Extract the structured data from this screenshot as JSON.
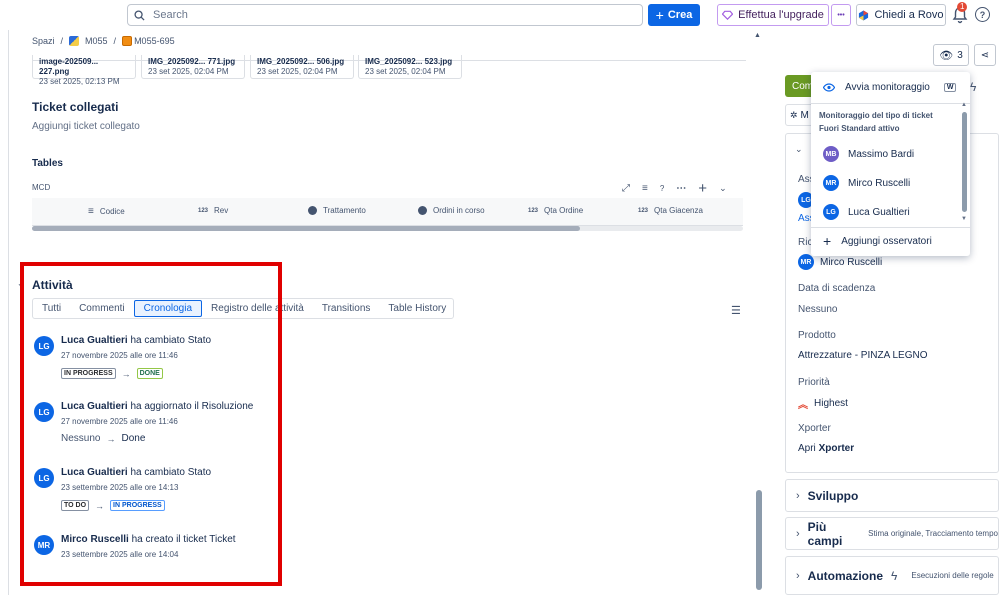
{
  "topbar": {
    "search_placeholder": "Search",
    "create_label": "Crea",
    "upgrade_label": "Effettua l'upgrade",
    "more_label": "•••",
    "rovo_label": "Chiedi a Rovo",
    "notifications_count": "1",
    "help_label": "?"
  },
  "breadcrumb": {
    "spaces": "Spazi",
    "project": "M055",
    "ticket": "M055-695"
  },
  "attachments": [
    {
      "name": "image-202509... 227.png",
      "date": "23 set 2025, 02:13 PM"
    },
    {
      "name": "IMG_2025092... 771.jpg",
      "date": "23 set 2025, 02:04 PM"
    },
    {
      "name": "IMG_2025092... 506.jpg",
      "date": "23 set 2025, 02:04 PM"
    },
    {
      "name": "IMG_2025092... 523.jpg",
      "date": "23 set 2025, 02:04 PM"
    }
  ],
  "linked_tickets": {
    "title": "Ticket collegati",
    "add": "Aggiungi ticket collegato"
  },
  "tables": {
    "title": "Tables",
    "name": "MCD",
    "columns": [
      {
        "label": "Codice",
        "icon": "lines-icon"
      },
      {
        "label": "Rev",
        "icon": "123"
      },
      {
        "label": "Trattamento",
        "icon": "chevron-circle-icon"
      },
      {
        "label": "Ordini in corso",
        "icon": "chevron-circle-icon"
      },
      {
        "label": "Qta Ordine",
        "icon": "123"
      },
      {
        "label": "Qta Giacenza",
        "icon": "123"
      }
    ]
  },
  "activity": {
    "title": "Attività",
    "tabs": [
      "Tutti",
      "Commenti",
      "Cronologia",
      "Registro delle attività",
      "Transitions",
      "Table History"
    ],
    "active_tab": "Cronologia",
    "items": [
      {
        "initials": "LG",
        "user": "Luca Gualtieri",
        "action": "ha cambiato",
        "field": "Stato",
        "date": "27 novembre 2025 alle ore 11:46",
        "from": "IN PROGRESS",
        "to": "DONE"
      },
      {
        "initials": "LG",
        "user": "Luca Gualtieri",
        "action": "ha aggiornato il",
        "field": "Risoluzione",
        "date": "27 novembre 2025 alle ore 11:46",
        "from": "Nessuno",
        "to": "Done"
      },
      {
        "initials": "LG",
        "user": "Luca Gualtieri",
        "action": "ha cambiato",
        "field": "Stato",
        "date": "23 settembre 2025 alle ore 14:13",
        "from": "TO DO",
        "to": "IN PROGRESS"
      },
      {
        "initials": "MR",
        "user": "Mirco Ruscelli",
        "action": "ha creato il ticket",
        "field": "Ticket",
        "date": "23 settembre 2025 alle ore 14:04"
      }
    ]
  },
  "right_panel": {
    "watch_count": "3",
    "status_button_partial": "Com",
    "row_m": "M",
    "assignee_label_partial": "Ass",
    "assignee_link_partial": "Ass",
    "reporter_label_partial": "Ric",
    "reporter": {
      "initials": "MR",
      "name": "Mirco Ruscelli"
    },
    "due_date_label": "Data di scadenza",
    "due_date_value": "Nessuno",
    "product_label": "Prodotto",
    "product_value": "Attrezzature - PINZA LEGNO",
    "priority_label": "Priorità",
    "priority_value": "Highest",
    "xporter_label": "Xporter",
    "xporter_prefix": "Apri",
    "xporter_value": "Xporter",
    "sections": [
      {
        "title": "Sviluppo",
        "sub": ""
      },
      {
        "title": "Più campi",
        "sub": "Stima originale, Tracciamento tempo"
      },
      {
        "title": "Automazione",
        "sub": "Esecuzioni delle regole"
      }
    ]
  },
  "watch_dropdown": {
    "start_watching": "Avvia monitoraggio",
    "shortcut": "W",
    "info_line1": "Monitoraggio del tipo di ticket",
    "info_line2": "Fuori Standard attivo",
    "watchers": [
      {
        "initials": "MB",
        "name": "Massimo Bardi",
        "color": "#6e5dc6"
      },
      {
        "initials": "MR",
        "name": "Mirco Ruscelli",
        "color": "#0c66e4"
      },
      {
        "initials": "LG",
        "name": "Luca Gualtieri",
        "color": "#0c66e4"
      }
    ],
    "add_watcher": "Aggiungi osservatori"
  }
}
